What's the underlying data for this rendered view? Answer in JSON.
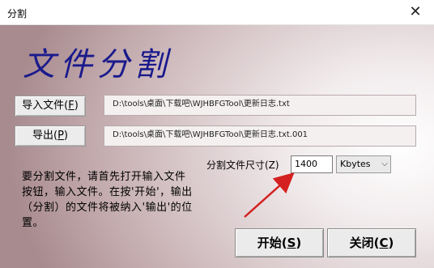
{
  "window": {
    "title": "分割",
    "close_glyph": "✕"
  },
  "header": {
    "title": "文件分割"
  },
  "import_button": {
    "label": "导入文件(",
    "accel": "F",
    "suffix": ")"
  },
  "import_path": "D:\\tools\\桌面\\下载吧\\WJHBFGTool\\更新日志.txt",
  "export_button": {
    "label": "导出(",
    "accel": "P",
    "suffix": ")"
  },
  "export_path": "D:\\tools\\桌面\\下载吧\\WJHBFGTool\\更新日志.txt.001",
  "split_size": {
    "label": "分割文件尺寸(Z)",
    "value": "1400",
    "unit": "Kbytes"
  },
  "description": "要分割文件，请首先打开输入文件按钮，输入文件。在按'开始'，输出（分割）的文件将被纳入'输出'的位置。",
  "start_button": {
    "label": "开始(",
    "accel": "S",
    "suffix": ")"
  },
  "close_button": {
    "label": "关闭(",
    "accel": "C",
    "suffix": ")"
  },
  "colors": {
    "title_blue": "#1a1a8c",
    "arrow_red": "#d42020"
  }
}
